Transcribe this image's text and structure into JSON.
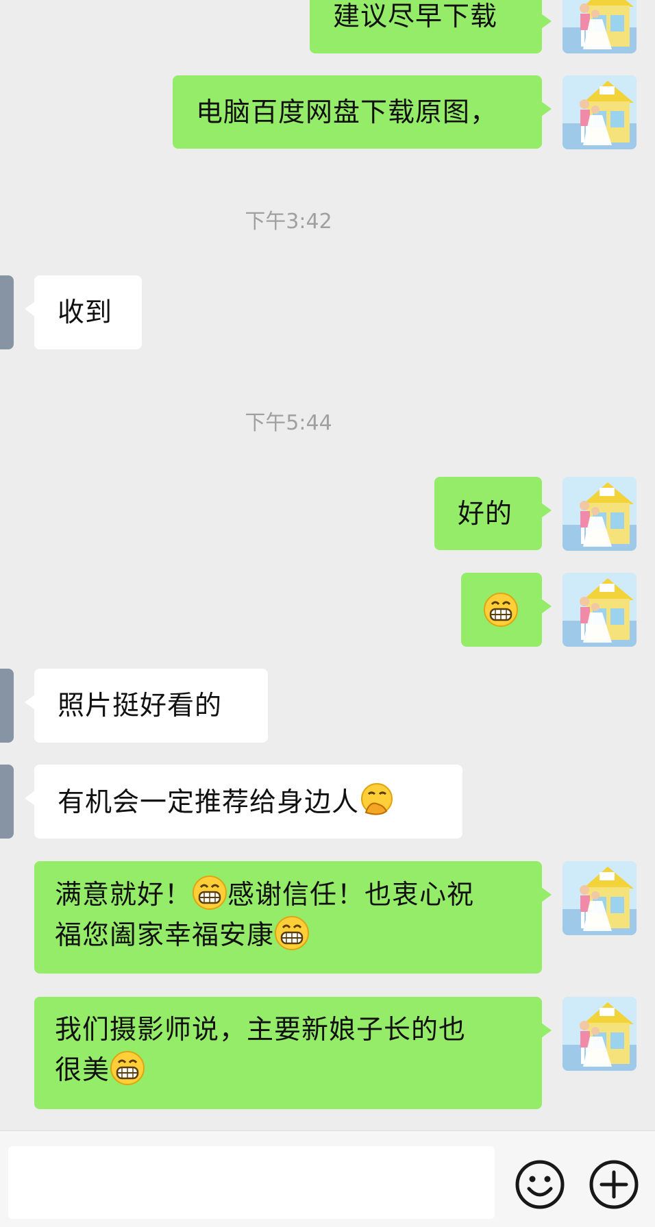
{
  "messages": [
    {
      "side": "right",
      "text": "建议尽早下载"
    },
    {
      "side": "right",
      "text": "电脑百度网盘下载原图，"
    },
    {
      "type": "time",
      "text": "下午3:42"
    },
    {
      "side": "left",
      "text": "收到"
    },
    {
      "type": "time",
      "text": "下午5:44"
    },
    {
      "side": "right",
      "text": "好的"
    },
    {
      "side": "right",
      "emoji": "grin-emoji"
    },
    {
      "side": "left",
      "text": "照片挺好看的"
    },
    {
      "side": "left",
      "text": "有机会一定推荐给身边人",
      "emoji": "hand-over-mouth-emoji"
    },
    {
      "side": "right",
      "line1a": "满意就好！",
      "line1b": "感谢信任！也衷心祝",
      "line2": "福您阖家幸福安康",
      "emoji": "grin-emoji"
    },
    {
      "side": "right",
      "line1": "我们摄影师说，主要新娘子长的也",
      "line2": "很美",
      "emoji": "grin-emoji"
    }
  ],
  "input_bar": {
    "text": "",
    "icons": [
      "emoji-icon",
      "add-icon"
    ]
  },
  "colors": {
    "background": "#ededed",
    "bubble_self": "#95ec69",
    "bubble_other": "#ffffff",
    "timestamp": "#a0a0a0"
  }
}
